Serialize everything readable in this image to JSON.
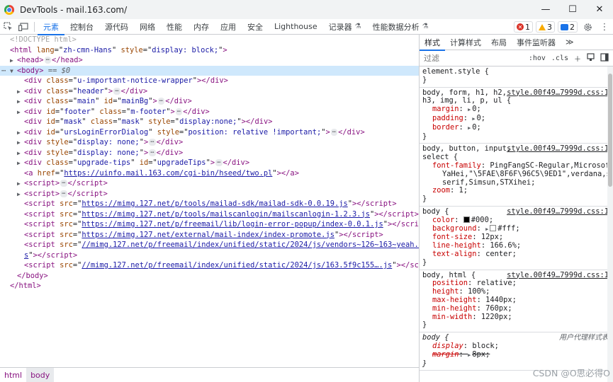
{
  "window": {
    "title": "DevTools - mail.163.com/",
    "controls": [
      "—",
      "☐",
      "✕"
    ]
  },
  "toolbar": {
    "tabs": [
      {
        "label": "元素",
        "active": true
      },
      {
        "label": "控制台"
      },
      {
        "label": "源代码"
      },
      {
        "label": "网络"
      },
      {
        "label": "性能"
      },
      {
        "label": "内存"
      },
      {
        "label": "应用"
      },
      {
        "label": "安全"
      },
      {
        "label": "Lighthouse"
      },
      {
        "label": "记录器",
        "flask": true
      },
      {
        "label": "性能数据分析",
        "flask": true
      }
    ],
    "errors": "1",
    "warnings": "3",
    "messages": "2"
  },
  "elements": {
    "doctype": "<!DOCTYPE html>",
    "html_tag": "html",
    "html_lang": "zh-cmn-Hans",
    "html_style": "display: block;",
    "head": "head",
    "body": "body",
    "eq0": "== $0",
    "children": [
      {
        "tag": "div",
        "attrs": [
          [
            "class",
            "u-important-notice-wrapper"
          ]
        ],
        "empty": true
      },
      {
        "tag": "div",
        "attrs": [
          [
            "class",
            "header"
          ]
        ],
        "collapsed": true
      },
      {
        "tag": "div",
        "attrs": [
          [
            "class",
            "main"
          ],
          [
            "id",
            "mainBg"
          ]
        ],
        "collapsed": true
      },
      {
        "tag": "div",
        "attrs": [
          [
            "id",
            "footer"
          ],
          [
            "class",
            "m-footer"
          ]
        ],
        "collapsed": true
      },
      {
        "tag": "div",
        "attrs": [
          [
            "id",
            "mask"
          ],
          [
            "class",
            "mask"
          ],
          [
            "style",
            "display:none;"
          ]
        ],
        "empty": true
      },
      {
        "tag": "div",
        "attrs": [
          [
            "id",
            "ursLoginErrorDialog"
          ],
          [
            "style",
            "position: relative !important;"
          ]
        ],
        "collapsed": true
      },
      {
        "tag": "div",
        "attrs": [
          [
            "style",
            "display: none;"
          ]
        ],
        "collapsed": true
      },
      {
        "tag": "div",
        "attrs": [
          [
            "style",
            "display: none;"
          ]
        ],
        "collapsed": true
      },
      {
        "tag": "div",
        "attrs": [
          [
            "class",
            "upgrade-tips"
          ],
          [
            "id",
            "upgradeTips"
          ]
        ],
        "collapsed": true
      },
      {
        "tag": "a",
        "attrs": [
          [
            "href",
            "https://uinfo.mail.163.com/cgi-bin/hseed/two.pl"
          ]
        ],
        "empty": true,
        "link": true,
        "noarrow": true
      },
      {
        "tag": "script",
        "collapsed": true
      },
      {
        "tag": "script",
        "collapsed": true
      },
      {
        "tag": "script",
        "attrs": [
          [
            "src",
            "https://mimg.127.net/p/tools/mailad-sdk/mailad-sdk-0.0.19.js"
          ]
        ],
        "empty": true,
        "link": true,
        "noarrow": true
      },
      {
        "tag": "script",
        "attrs": [
          [
            "src",
            "https://mimg.127.net/p/tools/mailscanlogin/mailscanlogin-1.2.3.js"
          ]
        ],
        "empty": true,
        "link": true,
        "noarrow": true
      },
      {
        "tag": "script",
        "attrs": [
          [
            "src",
            "https://mimg.127.net/p/freemail/lib/login-error-popup/index-0.0.1.js"
          ]
        ],
        "empty": true,
        "link": true,
        "noarrow": true
      },
      {
        "tag": "script",
        "attrs": [
          [
            "src",
            "https://mimg.127.net/external/mail-index/index-promote.js"
          ]
        ],
        "empty": true,
        "link": true,
        "noarrow": true
      },
      {
        "tag": "script",
        "attrs": [
          [
            "src",
            "//mimg.127.net/p/freemail/index/unified/static/2024/js/vendors~126~163~yeah.06f721a…j"
          ]
        ],
        "link": true,
        "noarrow": true,
        "wrap": "s",
        "empty": true
      },
      {
        "tag": "script",
        "attrs": [
          [
            "src",
            "//mimg.127.net/p/freemail/index/unified/static/2024/js/163.5f9c155….js"
          ]
        ],
        "empty": true,
        "link": true,
        "noarrow": true
      }
    ],
    "body_close": "</body>",
    "html_close": "</html>"
  },
  "breadcrumbs": [
    "html",
    "body"
  ],
  "styles": {
    "tabs": [
      "样式",
      "计算样式",
      "布局",
      "事件监听器"
    ],
    "more": "≫",
    "filter_placeholder": "过滤",
    "hov": ":hov",
    "cls": ".cls",
    "rules": [
      {
        "selector": "element.style {",
        "decls": [],
        "close": "}"
      },
      {
        "selector": "body, form, h1, h2, h3, img, li, p, ul {",
        "source": "style.00f49…7999d.css:1",
        "decls": [
          {
            "n": "margin",
            "v": "0;",
            "tri": true
          },
          {
            "n": "padding",
            "v": "0;",
            "tri": true
          },
          {
            "n": "border",
            "v": "0;",
            "tri": true
          }
        ],
        "close": "}"
      },
      {
        "selector": "body, button, input, select {",
        "source": "style.00f49…7999d.css:1",
        "decls": [
          {
            "n": "font-family",
            "v": "PingFangSC-Regular,Microsoft"
          },
          {
            "cont": "YaHei,\"\\5FAE\\8F6F\\96C5\\9ED1\",verdana,san"
          },
          {
            "cont": "serif,Simsun,STXihei;"
          },
          {
            "n": "zoom",
            "v": "1;"
          }
        ],
        "close": "}"
      },
      {
        "selector": "body {",
        "source": "style.00f49…7999d.css:1",
        "decls": [
          {
            "n": "color",
            "v": "#000;",
            "swatch": "#000000"
          },
          {
            "n": "background",
            "v": "#fff;",
            "tri": true,
            "swatch": "#ffffff"
          },
          {
            "n": "font-size",
            "v": "12px;"
          },
          {
            "n": "line-height",
            "v": "166.6%;"
          },
          {
            "n": "text-align",
            "v": "center;"
          }
        ],
        "close": "}"
      },
      {
        "selector": "body, html {",
        "source": "style.00f49…7999d.css:1",
        "decls": [
          {
            "n": "position",
            "v": "relative;"
          },
          {
            "n": "height",
            "v": "100%;"
          },
          {
            "n": "max-height",
            "v": "1440px;"
          },
          {
            "n": "min-height",
            "v": "760px;"
          },
          {
            "n": "min-width",
            "v": "1220px;"
          }
        ],
        "close": "}"
      },
      {
        "selector": "body {",
        "source": "用户代理样式表",
        "ua": true,
        "decls": [
          {
            "n": "display",
            "v": "block;"
          },
          {
            "n": "margin",
            "v": "8px;",
            "struck": true,
            "tri": true
          }
        ],
        "close": "}"
      }
    ]
  },
  "watermark": "CSDN @O思必得O"
}
